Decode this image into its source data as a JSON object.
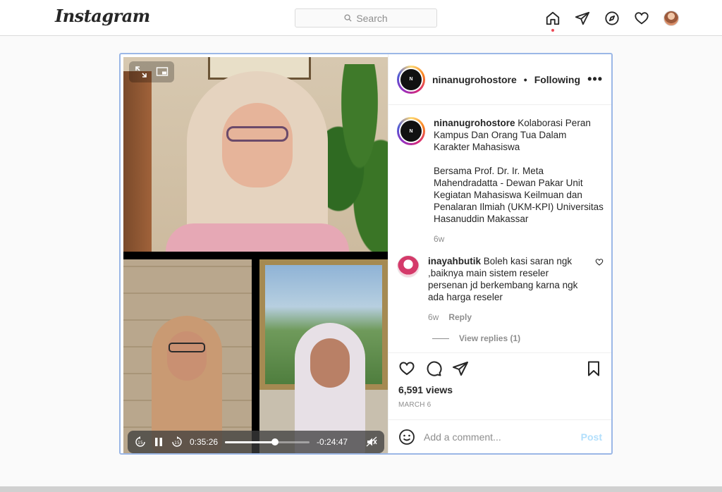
{
  "nav": {
    "logo": "Instagram",
    "search_placeholder": "Search",
    "icons": [
      "home-icon",
      "direct-icon",
      "explore-icon",
      "activity-heart-icon",
      "profile-avatar"
    ]
  },
  "post": {
    "username": "ninanugrohostore",
    "follow_sep": "•",
    "follow_status": "Following",
    "avatar_text": "N",
    "caption": {
      "username": "ninanugrohostore",
      "text1": "Kolaborasi Peran Kampus Dan Orang Tua Dalam Karakter Mahasiswa",
      "text2": "Bersama Prof. Dr. Ir. Meta Mahendradatta - Dewan Pakar Unit Kegiatan Mahasiswa Keilmuan dan Penalaran Ilmiah (UKM-KPI) Universitas Hasanuddin Makassar",
      "time": "6w"
    },
    "comments": [
      {
        "username": "inayahbutik",
        "text": "Boleh kasi saran ngk ,baiknya main sistem reseler persenan jd berkembang karna ngk ada harga reseler",
        "time": "6w",
        "reply_label": "Reply",
        "view_replies": "View replies (1)"
      }
    ],
    "views": "6,591 views",
    "date": "MARCH 6",
    "add_comment_placeholder": "Add a comment...",
    "post_button": "Post"
  },
  "video": {
    "elapsed": "0:35:26",
    "remaining": "-0:24:47",
    "progress": 0.59,
    "skip_back_label": "15",
    "skip_fwd_label": "15"
  },
  "colors": {
    "accent_blue": "#0095f6",
    "post_disabled": "#b2dffc",
    "notification_dot": "#ed4956",
    "modal_border": "#9bb7e6"
  }
}
